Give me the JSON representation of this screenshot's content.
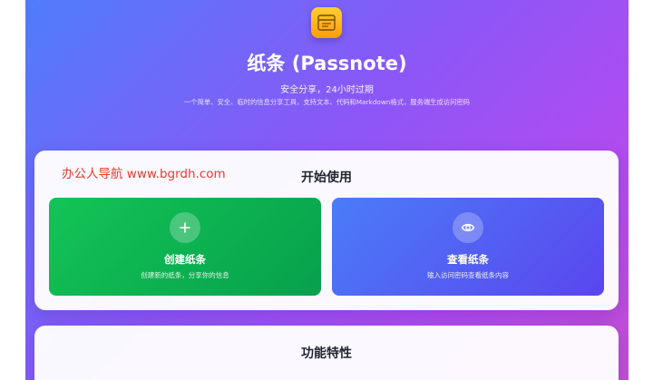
{
  "header": {
    "logo_icon": "note-icon",
    "title": "纸条 (Passnote)",
    "subtitle": "安全分享，24小时过期",
    "description": "一个简单、安全、临时的信息分享工具，支持文本、代码和Markdown格式，服务端生成访问密码"
  },
  "watermark": "办公人导航 www.bgrdh.com",
  "start_section": {
    "title": "开始使用",
    "create": {
      "icon": "plus-icon",
      "title": "创建纸条",
      "description": "创建新的纸条，分享你的信息"
    },
    "view": {
      "icon": "eye-icon",
      "title": "查看纸条",
      "description": "输入访问密码查看纸条内容"
    }
  },
  "features_section": {
    "title": "功能特性"
  },
  "colors": {
    "create_green": "#0db552",
    "view_blue": "#4f63f2",
    "logo_orange": "#ffb21c",
    "watermark_red": "#e53a2e"
  }
}
